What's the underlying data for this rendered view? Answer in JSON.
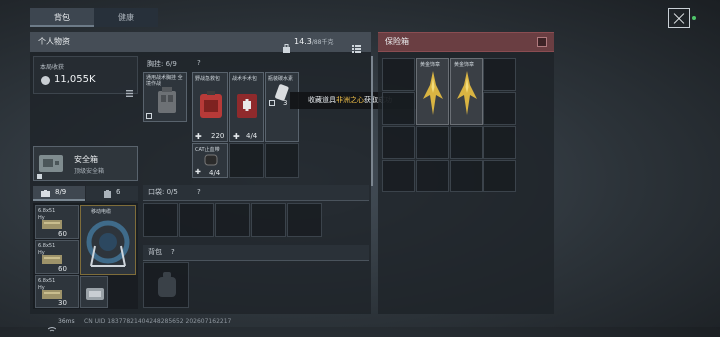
{
  "tabs": [
    {
      "label": "背包"
    },
    {
      "label": "健康"
    }
  ],
  "personal": {
    "title": "个人物资",
    "weight": "14.3",
    "weight_cap": "/88千克",
    "round_income_label": "本局收获",
    "round_income_value": "11,055K"
  },
  "chest": {
    "label": "胸挂: 6/9",
    "help": "?",
    "items": [
      {
        "name": "通用战术胸挂 全境作战",
        "qty": ""
      },
      {
        "name": "野战急救包",
        "qty": "220"
      },
      {
        "name": "战术手术包",
        "qty": "4/4"
      },
      {
        "name": "瓶装碳水素",
        "qty": "3"
      },
      {
        "name": "CAT止血带",
        "qty": "4/4"
      }
    ]
  },
  "toast": {
    "prefix": "收藏道具",
    "highlight": "非洲之心",
    "suffix": "获取成功"
  },
  "safe_box": {
    "label": "安全箱",
    "sub": "顶级安全箱"
  },
  "bottom_tabs": [
    {
      "label": "8/9"
    },
    {
      "label": "6"
    }
  ],
  "ammo": [
    {
      "name": "6.8x51",
      "sub": "Hy",
      "qty": "60"
    },
    {
      "name": "6.8x51",
      "sub": "Hy",
      "qty": "60"
    },
    {
      "name": "6.8x51",
      "sub": "Hy",
      "qty": "30"
    }
  ],
  "mobile_item": {
    "label": "移动电缆"
  },
  "pouch": {
    "label": "口袋: 0/5",
    "help": "?"
  },
  "backpack": {
    "label": "背包",
    "help": "?"
  },
  "safe_panel": {
    "title": "保险箱",
    "items": [
      {
        "label": "黄金饰章"
      },
      {
        "label": "黄金饰章"
      }
    ]
  },
  "status": {
    "ping": "36ms",
    "uid": "CN UID 18377821404248285652 202607162217"
  },
  "colors": {
    "accent_red": "#6a3e42",
    "highlight_text": "#f2c14a"
  }
}
